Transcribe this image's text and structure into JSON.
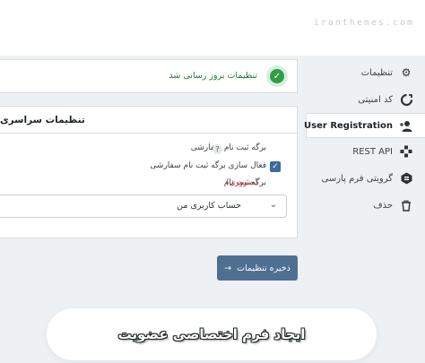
{
  "watermark": "iranthemes.com",
  "sidebar": {
    "items": [
      {
        "label": "تنظیمات",
        "icon": "gear-icon"
      },
      {
        "label": "کد امنیتی",
        "icon": "captcha-icon"
      },
      {
        "label": "User Registration",
        "icon": "user-plus-icon"
      },
      {
        "label": "REST API",
        "icon": "api-icon"
      },
      {
        "label": "گرویتی فرم پارسی",
        "icon": "gravity-forms-icon"
      },
      {
        "label": "حذف",
        "icon": "trash-icon"
      }
    ],
    "active_index": 2
  },
  "notice": {
    "message": "تنظیمات بروز رسانی شد",
    "icon": "check-icon",
    "status_color": "#2f9e44"
  },
  "panel": {
    "title": "تنظیمات سراسری",
    "custom_reg_page_label": "برگه ثبت نام سفارشی",
    "help_glyph": "?",
    "enable_checkbox_label": "فعال سازی برگه ثبت نام سفارشی",
    "enable_checkbox_checked": true,
    "reg_page_label": "برگه ثبت نام",
    "required_label": "(ضروری)",
    "reg_page_select_value": "حساب کاربری من"
  },
  "save_button": {
    "label": "ذخیره تنظیمات",
    "icon": "arrow-left-icon",
    "color": "#4f6f92"
  },
  "banner": {
    "caption": "ایجاد فرم اختصاصی عضویت"
  }
}
